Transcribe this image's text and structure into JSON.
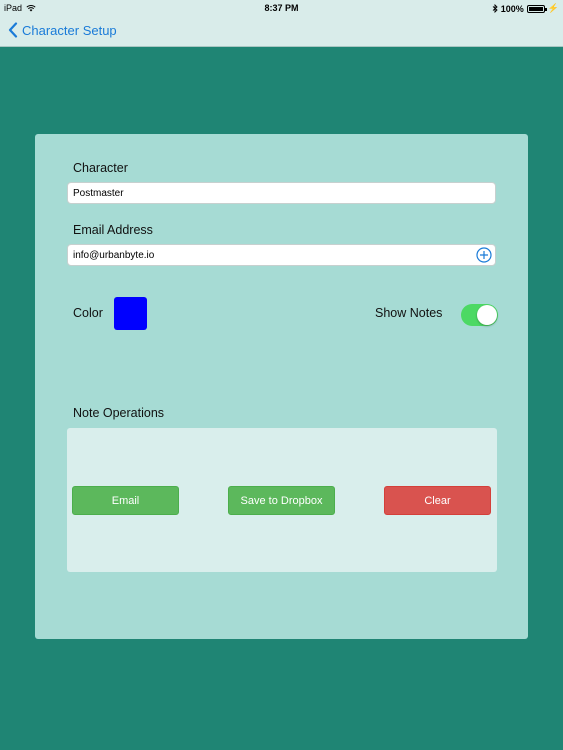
{
  "status_bar": {
    "device": "iPad",
    "time": "8:37 PM",
    "battery": "100%"
  },
  "nav": {
    "back_label": "Character Setup"
  },
  "form": {
    "character_label": "Character",
    "character_value": "Postmaster",
    "email_label": "Email Address",
    "email_value": "info@urbanbyte.io",
    "color_label": "Color",
    "color_value": "#0000ff",
    "show_notes_label": "Show Notes",
    "show_notes_on": true
  },
  "note_ops": {
    "title": "Note Operations",
    "email_button": "Email",
    "dropbox_button": "Save to Dropbox",
    "clear_button": "Clear"
  },
  "colors": {
    "background": "#1f8574",
    "card": "#a6dbd4",
    "accent_blue": "#1a7bd8",
    "success_green": "#5cb85c",
    "danger_red": "#d9534f",
    "toggle_green": "#4cd964"
  }
}
